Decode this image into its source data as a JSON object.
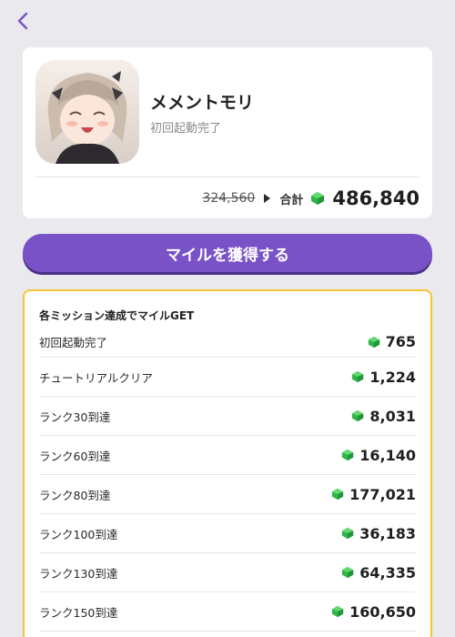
{
  "nav": {
    "back_icon": "chevron-left-icon",
    "accent": "#7a52c7"
  },
  "app": {
    "title": "メメントモリ",
    "subtitle": "初回起動完了",
    "icon": "app-icon-anime-girl"
  },
  "total": {
    "old_value": "324,560",
    "label": "合計",
    "value": "486,840",
    "currency_icon": "green-gem-icon"
  },
  "cta": {
    "label": "マイルを獲得する",
    "color": "#7a52c7"
  },
  "missions": {
    "heading": "各ミッション達成でマイルGET",
    "border_color": "#f5c531",
    "items": [
      {
        "label": "初回起動完了",
        "value": "765"
      },
      {
        "label": "チュートリアルクリア",
        "value": "1,224"
      },
      {
        "label": "ランク30到達",
        "value": "8,031"
      },
      {
        "label": "ランク60到達",
        "value": "16,140"
      },
      {
        "label": "ランク80到達",
        "value": "177,021"
      },
      {
        "label": "ランク100到達",
        "value": "36,183"
      },
      {
        "label": "ランク130到達",
        "value": "64,335"
      },
      {
        "label": "ランク150到達",
        "value": "160,650"
      }
    ]
  }
}
